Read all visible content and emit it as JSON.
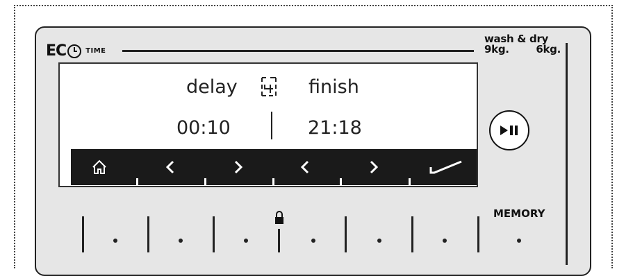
{
  "brand": {
    "logo_text": "EC",
    "time_label": "TIME"
  },
  "capacity": {
    "title": "wash & dry",
    "wash": "9kg.",
    "dry": "6kg."
  },
  "display": {
    "delay_label": "delay",
    "finish_label": "finish",
    "delay_value": "00:10",
    "finish_value": "21:18"
  },
  "navbar": {
    "buttons": [
      "home",
      "left",
      "right",
      "left",
      "right",
      "confirm"
    ]
  },
  "controls": {
    "memory_label": "MEMORY"
  },
  "icons": [
    "clock-icon",
    "calendar-icon",
    "home-icon",
    "chevron-left-icon",
    "chevron-right-icon",
    "check-icon",
    "play-pause-icon",
    "lock-icon"
  ]
}
